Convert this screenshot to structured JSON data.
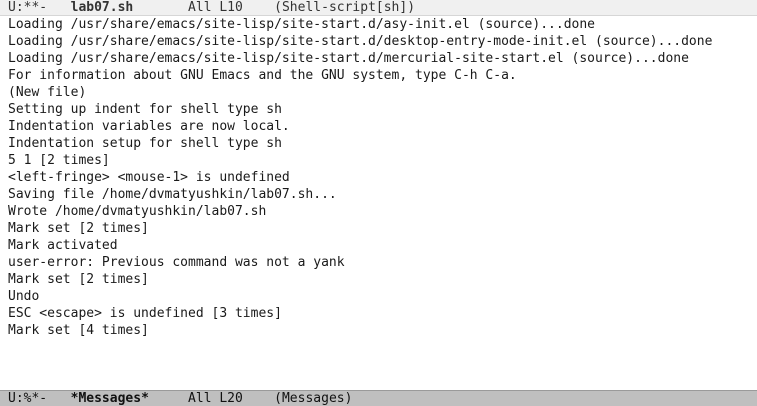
{
  "top_modeline": {
    "status": "U:**-",
    "buffer_name": "lab07.sh",
    "position": "All L10",
    "mode": "(Shell-script[sh])"
  },
  "messages_buffer": {
    "lines": [
      "Loading /usr/share/emacs/site-lisp/site-start.d/asy-init.el (source)...done",
      "Loading /usr/share/emacs/site-lisp/site-start.d/desktop-entry-mode-init.el (source)...done",
      "Loading /usr/share/emacs/site-lisp/site-start.d/mercurial-site-start.el (source)...done",
      "For information about GNU Emacs and the GNU system, type C-h C-a.",
      "(New file)",
      "Setting up indent for shell type sh",
      "Indentation variables are now local.",
      "Indentation setup for shell type sh",
      "5 1 [2 times]",
      "<left-fringe> <mouse-1> is undefined",
      "Saving file /home/dvmatyushkin/lab07.sh...",
      "Wrote /home/dvmatyushkin/lab07.sh",
      "Mark set [2 times]",
      "Mark activated",
      "user-error: Previous command was not a yank",
      "Mark set [2 times]",
      "Undo",
      "ESC <escape> is undefined [3 times]",
      "Mark set [4 times]"
    ]
  },
  "bottom_modeline": {
    "status": "U:%*-",
    "buffer_name": "*Messages*",
    "position": "All L20",
    "mode": "(Messages)"
  }
}
